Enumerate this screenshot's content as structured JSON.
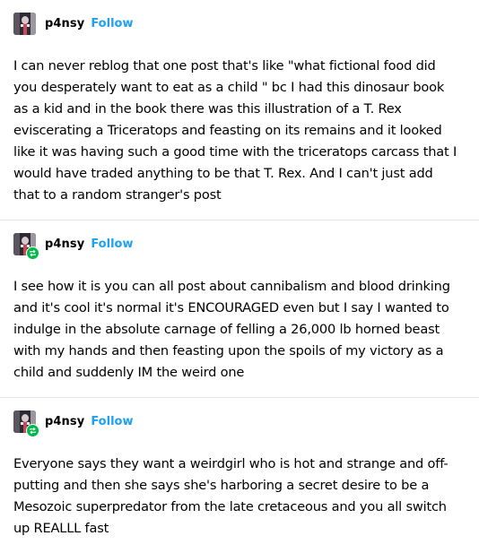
{
  "posts": [
    {
      "username": "p4nsy",
      "follow_label": "Follow",
      "avatar_icon": "user-avatar-icon",
      "reblogged": false,
      "text": "I can never reblog that one post that's like \"what fictional food did you desperately want to eat as a child \" bc I had this dinosaur book as a kid and in the book there was this illustration of a T. Rex eviscerating a Triceratops and feasting on its remains and it looked like it was having such a good time with the triceratops carcass that I would have traded anything to be that T. Rex. And I can't just add that to a random stranger's post"
    },
    {
      "username": "p4nsy",
      "follow_label": "Follow",
      "avatar_icon": "user-avatar-icon",
      "reblogged": true,
      "text": "I see how it is you can all post about cannibalism and blood drinking and it's cool it's normal it's ENCOURAGED even but I say I wanted to indulge in the absolute carnage of felling a 26,000 lb horned beast with my hands and then feasting upon the spoils of my victory as a child and suddenly IM the weird one"
    },
    {
      "username": "p4nsy",
      "follow_label": "Follow",
      "avatar_icon": "user-avatar-icon",
      "reblogged": true,
      "text": "Everyone says they want a weirdgirl who is hot and strange and off-putting and then she says she's harboring a secret desire to be a Mesozoic superpredator from the late cretaceous and you all switch up REALLL fast"
    }
  ],
  "colors": {
    "follow": "#1da1f2",
    "reblog_badge": "#00b84b",
    "divider": "#e4e4e4",
    "text": "#000000"
  }
}
